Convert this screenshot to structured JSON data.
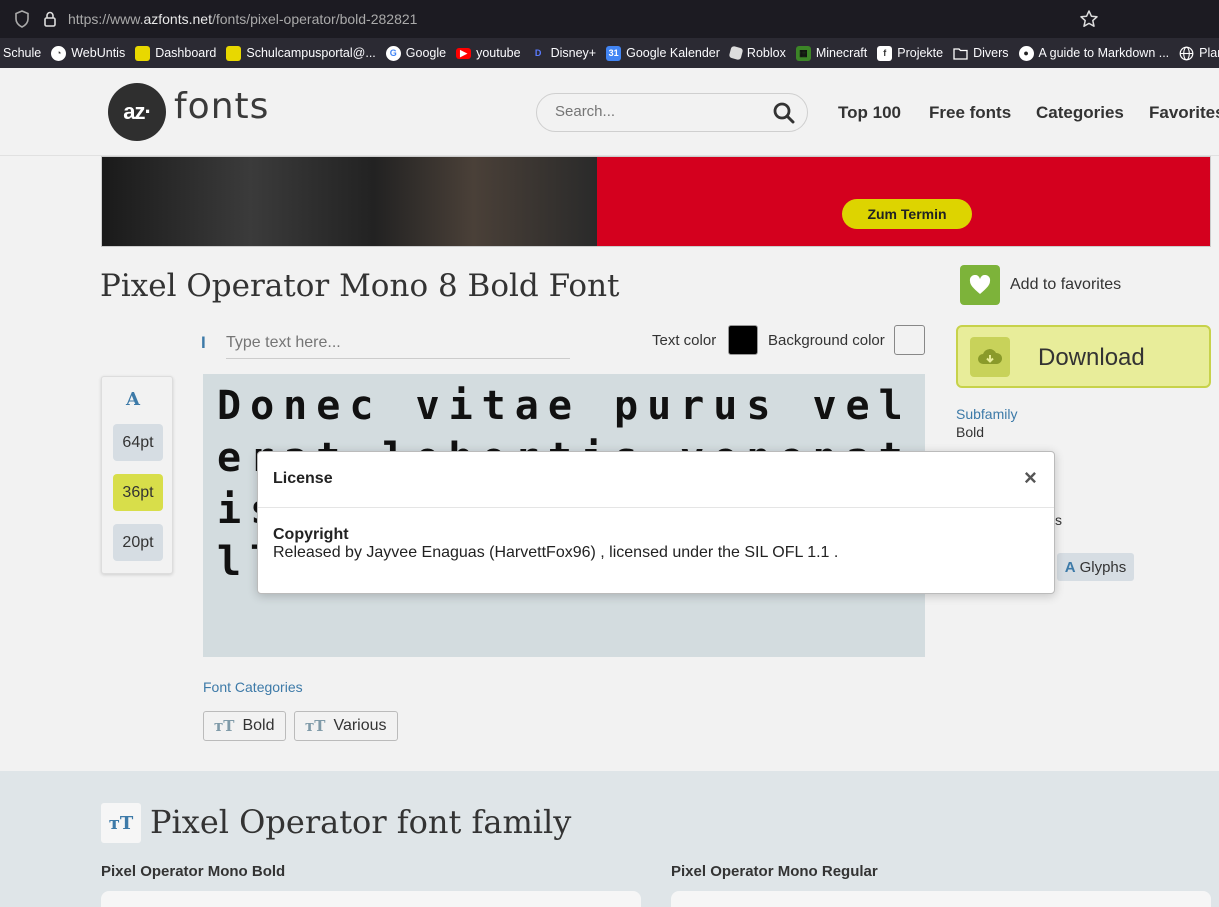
{
  "browser": {
    "url_prefix": "https://www.",
    "url_domain": "azfonts.net",
    "url_path": "/fonts/pixel-operator/bold-282821",
    "icons": {
      "shield": "shield-icon",
      "lock": "lock-icon",
      "star": "star-icon"
    }
  },
  "bookmarks": [
    {
      "label": "Schule",
      "color": ""
    },
    {
      "label": "WebUntis",
      "color": "#ffffff"
    },
    {
      "label": "Dashboard",
      "color": "#e8d800"
    },
    {
      "label": "Schulcampusportal@...",
      "color": "#e8d800"
    },
    {
      "label": "Google",
      "color": "#4285f4"
    },
    {
      "label": "youtube",
      "color": "#ff0000"
    },
    {
      "label": "Disney+",
      "color": "#3b5bdb"
    },
    {
      "label": "Google Kalender",
      "color": "#4285f4"
    },
    {
      "label": "Roblox",
      "color": "#dddddd"
    },
    {
      "label": "Minecraft",
      "color": "#3c8527"
    },
    {
      "label": "Projekte",
      "color": "#ffffff"
    },
    {
      "label": "Divers",
      "color": ""
    },
    {
      "label": "A guide to Markdown ...",
      "color": "#ffffff"
    },
    {
      "label": "Plans",
      "color": "#ffffff"
    }
  ],
  "header": {
    "logo_mark": "az·",
    "logo_text": "fonts",
    "search_placeholder": "Search...",
    "nav": [
      "Top 100",
      "Free fonts",
      "Categories",
      "Favorites"
    ]
  },
  "banner": {
    "cta": "Zum Termin",
    "accent": "#d4001e"
  },
  "font": {
    "title": "Pixel Operator Mono 8 Bold Font",
    "add_favorites": "Add to favorites",
    "download": "Download",
    "subfamily_label": "Subfamily",
    "subfamily_value": "Bold",
    "partial_text": "s",
    "glyphs": "Glyphs"
  },
  "preview_controls": {
    "input_placeholder": "Type text here...",
    "text_color_label": "Text color",
    "bg_color_label": "Background color",
    "sizes": [
      "64pt",
      "36pt",
      "20pt"
    ],
    "active_size": "36pt",
    "sample_text": "Donec vitae purus vel erat lobortis venenatis. Morbi vulputate ullamcorper ligula ne"
  },
  "categories": {
    "heading": "Font Categories",
    "items": [
      "Bold",
      "Various"
    ]
  },
  "family": {
    "title": "Pixel Operator font family",
    "items": [
      "Pixel Operator Mono Bold",
      "Pixel Operator Mono Regular"
    ]
  },
  "modal": {
    "title": "License",
    "close": "×",
    "copyright_label": "Copyright",
    "copyright_text": "Released by Jayvee Enaguas (HarvettFox96) , licensed under the SIL OFL 1.1 ."
  },
  "colors": {
    "accent_green": "#7db33a",
    "download_bg": "#e8ed9a",
    "link_blue": "#3d7aa8"
  }
}
